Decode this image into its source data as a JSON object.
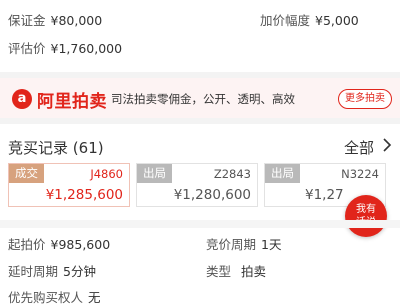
{
  "info_top": {
    "deposit_label": "保证金",
    "deposit_value": "¥80,000",
    "increment_label": "加价幅度",
    "increment_value": "¥5,000",
    "appraisal_label": "评估价",
    "appraisal_value": "¥1,760,000"
  },
  "banner": {
    "logo_icon": "alibaba-auction-logo",
    "logo_text": "阿里拍卖",
    "slogan": "司法拍卖零佣金，公开、透明、高效",
    "more_button": "更多拍卖"
  },
  "records": {
    "title": "竞买记录",
    "count": "(61)",
    "all_label": "全部",
    "chevron_icon": "chevron-right-icon",
    "items": [
      {
        "status": "成交",
        "code": "J4860",
        "price": "¥1,285,600"
      },
      {
        "status": "出局",
        "code": "Z2843",
        "price": "¥1,280,600"
      },
      {
        "status": "出局",
        "code": "N3224",
        "price": "¥1,27"
      }
    ]
  },
  "chat_button": {
    "line1": "我有",
    "line2": "话说"
  },
  "info_bottom": {
    "start_price_label": "起拍价",
    "start_price_value": "¥985,600",
    "cycle_label": "竞价周期",
    "cycle_value": "1天",
    "delay_label": "延时周期",
    "delay_value": "5分钟",
    "type_label": "类型",
    "type_value": "拍卖",
    "priority_label": "优先购买权人",
    "priority_value": "无"
  },
  "colors": {
    "accent": "#e1251b",
    "win_tag": "#d7a27e",
    "out_tag": "#b9b9b9"
  }
}
